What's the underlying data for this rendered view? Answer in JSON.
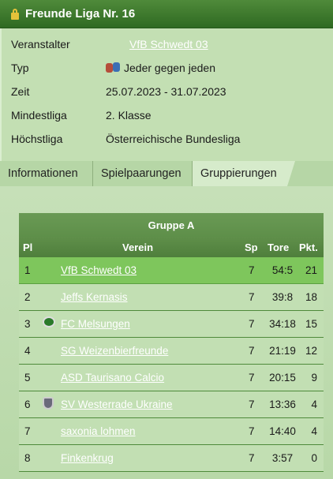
{
  "header": {
    "title": "Freunde Liga Nr. 16"
  },
  "details": [
    {
      "label": "Veranstalter",
      "value": "VfB Schwedt 03",
      "link": true
    },
    {
      "label": "Typ",
      "value": "Jeder gegen jeden",
      "icon": "versus-icon"
    },
    {
      "label": "Zeit",
      "value": "25.07.2023 - 31.07.2023"
    },
    {
      "label": "Mindestliga",
      "value": "2. Klasse"
    },
    {
      "label": "Höchstliga",
      "value": "Österreichische Bundesliga"
    }
  ],
  "tabs": [
    {
      "label": "Informationen"
    },
    {
      "label": "Spielpaarungen"
    },
    {
      "label": "Gruppierungen",
      "active": true
    }
  ],
  "group": {
    "title": "Gruppe A",
    "columns": {
      "pl": "Pl",
      "verein": "Verein",
      "sp": "Sp",
      "tore": "Tore",
      "pkt": "Pkt."
    },
    "rows": [
      {
        "pl": "1",
        "team": "VfB Schwedt 03",
        "sp": "7",
        "tore": "54:5",
        "pkt": "21",
        "highlight": true
      },
      {
        "pl": "2",
        "team": "Jeffs Kernasis",
        "sp": "7",
        "tore": "39:8",
        "pkt": "18"
      },
      {
        "pl": "3",
        "team": "FC Melsungen",
        "sp": "7",
        "tore": "34:18",
        "pkt": "15",
        "logo": "fc-melsungen-logo"
      },
      {
        "pl": "4",
        "team": "SG Weizenbierfreunde",
        "sp": "7",
        "tore": "21:19",
        "pkt": "12"
      },
      {
        "pl": "5",
        "team": "ASD Taurisano Calcio",
        "sp": "7",
        "tore": "20:15",
        "pkt": "9"
      },
      {
        "pl": "6",
        "team": "SV Westerrade Ukraine",
        "sp": "7",
        "tore": "13:36",
        "pkt": "4",
        "logo": "sv-westerrade-logo"
      },
      {
        "pl": "7",
        "team": "saxonia lohmen",
        "sp": "7",
        "tore": "14:40",
        "pkt": "4"
      },
      {
        "pl": "8",
        "team": "Finkenkrug",
        "sp": "7",
        "tore": "3:57",
        "pkt": "0"
      }
    ]
  },
  "colors": {
    "header": "#2f6a22",
    "highlight": "#7ec65c",
    "panel": "#c2dfb3"
  }
}
